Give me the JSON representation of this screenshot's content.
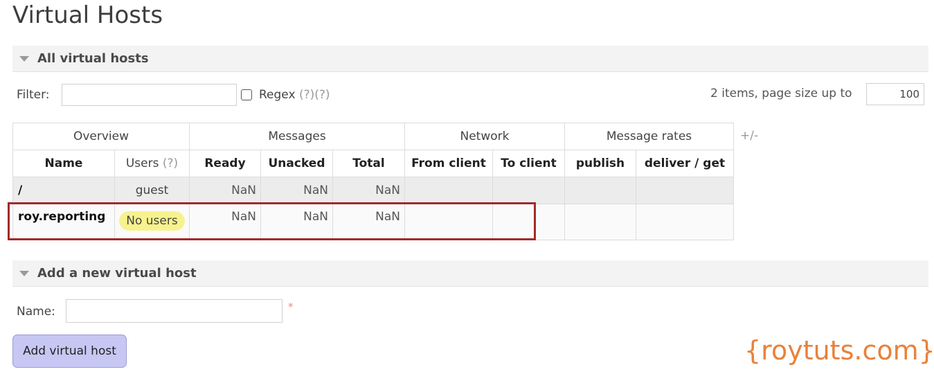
{
  "page_title": "Virtual Hosts",
  "section_all": {
    "label": "All virtual hosts"
  },
  "filter": {
    "label": "Filter:",
    "value": "",
    "regex_label": "Regex",
    "regex_help": "(?)(?)",
    "regex_checked": false
  },
  "paging": {
    "info": "2 items, page size up to",
    "page_size": "100"
  },
  "table": {
    "groups": {
      "overview": "Overview",
      "messages": "Messages",
      "network": "Network",
      "message_rates": "Message rates"
    },
    "plus_minus": "+/-",
    "columns": {
      "name": "Name",
      "users": "Users",
      "users_help": "(?)",
      "ready": "Ready",
      "unacked": "Unacked",
      "total": "Total",
      "from_client": "From client",
      "to_client": "To client",
      "publish": "publish",
      "deliver_get": "deliver / get"
    },
    "rows": [
      {
        "name": "/",
        "users": "guest",
        "ready": "NaN",
        "unacked": "NaN",
        "total": "NaN",
        "from_client": "",
        "to_client": "",
        "publish": "",
        "deliver_get": ""
      },
      {
        "name": "roy.reporting",
        "users": "No users",
        "ready": "NaN",
        "unacked": "NaN",
        "total": "NaN",
        "from_client": "",
        "to_client": "",
        "publish": "",
        "deliver_get": ""
      }
    ]
  },
  "section_add": {
    "label": "Add a new virtual host"
  },
  "add_form": {
    "name_label": "Name:",
    "name_value": "",
    "required_mark": "*",
    "submit_label": "Add virtual host"
  },
  "watermark": "{roytuts.com}",
  "colors": {
    "highlight_border": "#a22a2a",
    "no_users_badge": "#f7f28e",
    "button_bg": "#c7c7f4",
    "watermark": "#e8823a"
  }
}
